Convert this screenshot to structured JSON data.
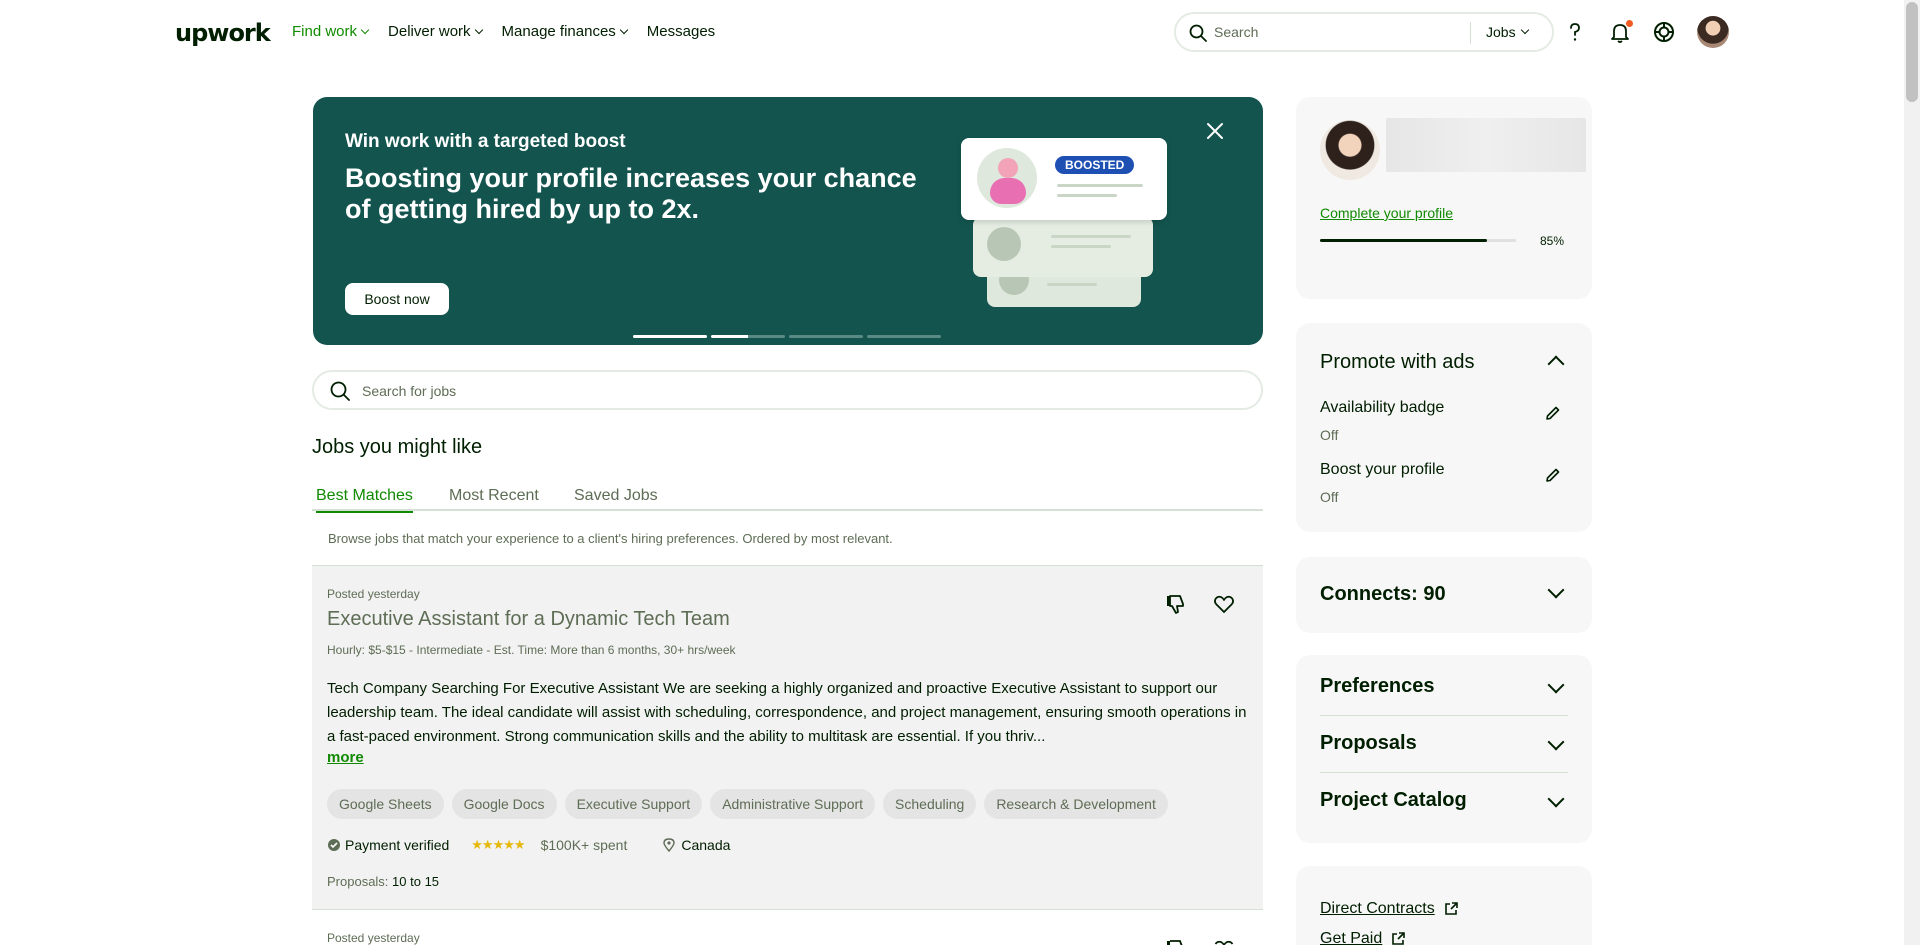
{
  "header": {
    "logo": "upwork",
    "nav": [
      {
        "label": "Find work",
        "active": true,
        "dropdown": true
      },
      {
        "label": "Deliver work",
        "active": false,
        "dropdown": true
      },
      {
        "label": "Manage finances",
        "active": false,
        "dropdown": true
      },
      {
        "label": "Messages",
        "active": false,
        "dropdown": false
      }
    ],
    "search": {
      "placeholder": "Search",
      "scope": "Jobs"
    },
    "icons": [
      "help-icon",
      "bell-icon",
      "apps-icon",
      "avatar"
    ]
  },
  "banner": {
    "kicker": "Win work with a targeted boost",
    "title": "Boosting your profile increases your chance of getting hired by up to 2x.",
    "button": "Boost now",
    "tag": "BOOSTED",
    "slides": 4,
    "active_slide": 1
  },
  "job_search": {
    "placeholder": "Search for jobs"
  },
  "jobs_section": {
    "title": "Jobs you might like",
    "tabs": [
      {
        "label": "Best Matches",
        "active": true
      },
      {
        "label": "Most Recent",
        "active": false
      },
      {
        "label": "Saved Jobs",
        "active": false
      }
    ],
    "description": "Browse jobs that match your experience to a client's hiring preferences. Ordered by most relevant."
  },
  "jobs": [
    {
      "posted": "Posted yesterday",
      "title": "Executive Assistant for a Dynamic Tech Team",
      "meta": "Hourly: $5-$15 - Intermediate - Est. Time: More than 6 months, 30+ hrs/week",
      "description": "Tech Company Searching For Executive Assistant We are seeking a highly organized and proactive Executive Assistant to support our leadership team. The ideal candidate will assist with scheduling, correspondence, and project management, ensuring smooth operations in a fast-paced environment. Strong communication skills and the ability to multitask are essential. If you thriv...",
      "more": "more",
      "skills": [
        "Google Sheets",
        "Google Docs",
        "Executive Support",
        "Administrative Support",
        "Scheduling",
        "Research & Development"
      ],
      "payment": "Payment verified",
      "rating": 5,
      "spent": "$100K+ spent",
      "location": "Canada",
      "proposals_label": "Proposals:",
      "proposals_value": "10 to 15"
    },
    {
      "posted": "Posted yesterday"
    }
  ],
  "sidebar": {
    "profile": {
      "complete_link": "Complete your profile",
      "progress": 0.85,
      "progress_label": "85%"
    },
    "ads": {
      "title": "Promote with ads",
      "items": [
        {
          "label": "Availability badge",
          "value": "Off"
        },
        {
          "label": "Boost your profile",
          "value": "Off"
        }
      ]
    },
    "connects": {
      "label": "Connects: 90"
    },
    "sections": [
      "Preferences",
      "Proposals",
      "Project Catalog"
    ],
    "links": [
      "Direct Contracts",
      "Get Paid"
    ]
  },
  "colors": {
    "brand_green": "#108a00",
    "banner_bg": "#13544e",
    "text": "#001e00",
    "muted": "#5e6d55",
    "star": "#e5b80b",
    "boosted_tag": "#1e4fb3"
  }
}
